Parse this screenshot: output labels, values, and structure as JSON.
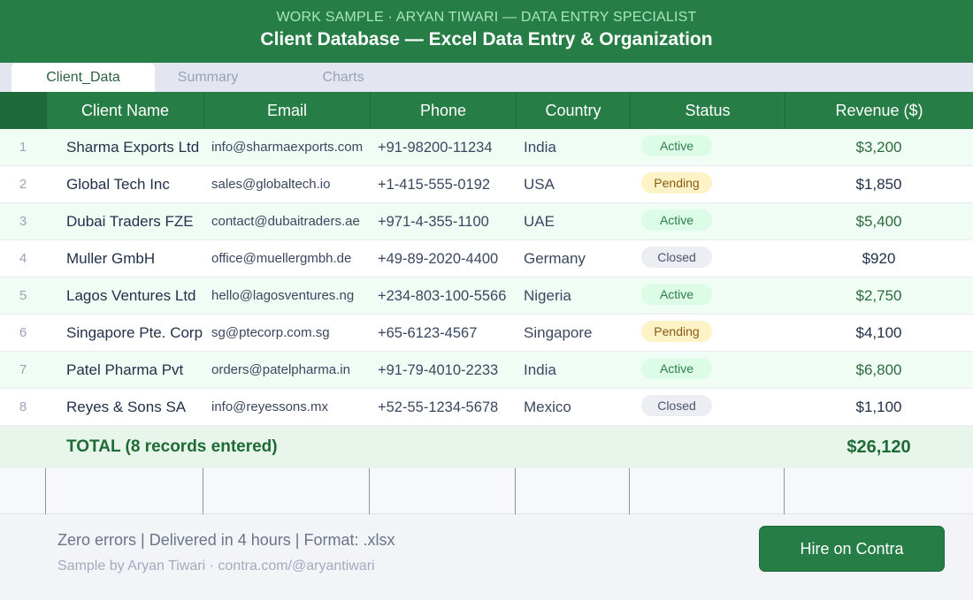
{
  "header": {
    "kicker": "WORK SAMPLE · ARYAN TIWARI — DATA ENTRY SPECIALIST",
    "title": "Client Database — Excel Data Entry & Organization"
  },
  "tabs": [
    {
      "label": "Client_Data",
      "active": true
    },
    {
      "label": "Summary",
      "active": false
    },
    {
      "label": "Charts",
      "active": false
    }
  ],
  "table": {
    "columns": [
      "Client Name",
      "Email",
      "Phone",
      "Country",
      "Status",
      "Revenue ($)"
    ],
    "rows": [
      {
        "num": "1",
        "name": "Sharma Exports Ltd",
        "email": "info@sharmaexports.com",
        "phone": "+91-98200-11234",
        "country": "India",
        "status": "Active",
        "revenue": "$3,200"
      },
      {
        "num": "2",
        "name": "Global Tech Inc",
        "email": "sales@globaltech.io",
        "phone": "+1-415-555-0192",
        "country": "USA",
        "status": "Pending",
        "revenue": "$1,850"
      },
      {
        "num": "3",
        "name": "Dubai Traders FZE",
        "email": "contact@dubaitraders.ae",
        "phone": "+971-4-355-1100",
        "country": "UAE",
        "status": "Active",
        "revenue": "$5,400"
      },
      {
        "num": "4",
        "name": "Muller GmbH",
        "email": "office@muellergmbh.de",
        "phone": "+49-89-2020-4400",
        "country": "Germany",
        "status": "Closed",
        "revenue": "$920"
      },
      {
        "num": "5",
        "name": "Lagos Ventures Ltd",
        "email": "hello@lagosventures.ng",
        "phone": "+234-803-100-5566",
        "country": "Nigeria",
        "status": "Active",
        "revenue": "$2,750"
      },
      {
        "num": "6",
        "name": "Singapore Pte. Corp",
        "email": "sg@ptecorp.com.sg",
        "phone": "+65-6123-4567",
        "country": "Singapore",
        "status": "Pending",
        "revenue": "$4,100"
      },
      {
        "num": "7",
        "name": "Patel Pharma Pvt",
        "email": "orders@patelpharma.in",
        "phone": "+91-79-4010-2233",
        "country": "India",
        "status": "Active",
        "revenue": "$6,800"
      },
      {
        "num": "8",
        "name": "Reyes & Sons SA",
        "email": "info@reyessons.mx",
        "phone": "+52-55-1234-5678",
        "country": "Mexico",
        "status": "Closed",
        "revenue": "$1,100"
      }
    ],
    "total_label": "TOTAL (8 records entered)",
    "total_value": "$26,120"
  },
  "footer": {
    "line1": "Zero errors | Delivered in 4 hours | Format: .xlsx",
    "line2": "Sample by Aryan Tiwari · contra.com/@aryantiwari",
    "hire_label": "Hire on Contra"
  },
  "colors": {
    "brand_green": "#267d46",
    "active_badge_bg": "#dcfce7",
    "pending_badge_bg": "#fef3c7",
    "closed_badge_bg": "#eceef4"
  }
}
